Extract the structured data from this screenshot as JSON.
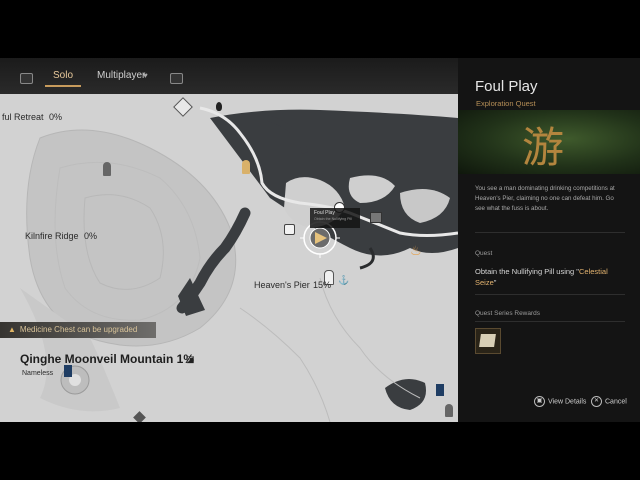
{
  "tabs": {
    "solo": "Solo",
    "multiplayer": "Multiplayer"
  },
  "map_labels": {
    "retreat": "ful Retreat",
    "retreat_pct": "0%",
    "kilnfire": "Kilnfire Ridge",
    "kilnfire_pct": "0%",
    "pier": "Heaven's Pier",
    "pier_pct": "15%",
    "mountain": "Qinghe Moonveil Mountain 1%",
    "mountain_sub": "Nameless",
    "marker_label": "Foul Play",
    "marker_sub": "Obtain the Nullifying Pill"
  },
  "notice": "Medicine Chest can be upgraded",
  "quest": {
    "title": "Foul Play",
    "type": "Exploration Quest",
    "art_glyph": "游",
    "description": "You see a man dominating drinking competitions at Heaven's Pier, claiming no one can defeat him. Go see what the fuss is about.",
    "quest_header": "Quest",
    "objective_prefix": "Obtain the Nullifying Pill using \"",
    "objective_highlight": "Celestial Seize",
    "objective_suffix": "\"",
    "rewards_header": "Quest Series Rewards"
  },
  "footer": {
    "view_details": "View Details",
    "cancel": "Cancel"
  },
  "colors": {
    "accent": "#c79b5c",
    "panel_bg": "#141414",
    "water": "#3a3d40",
    "land": "#d4d4d4",
    "highlight": "#e3b36f"
  }
}
